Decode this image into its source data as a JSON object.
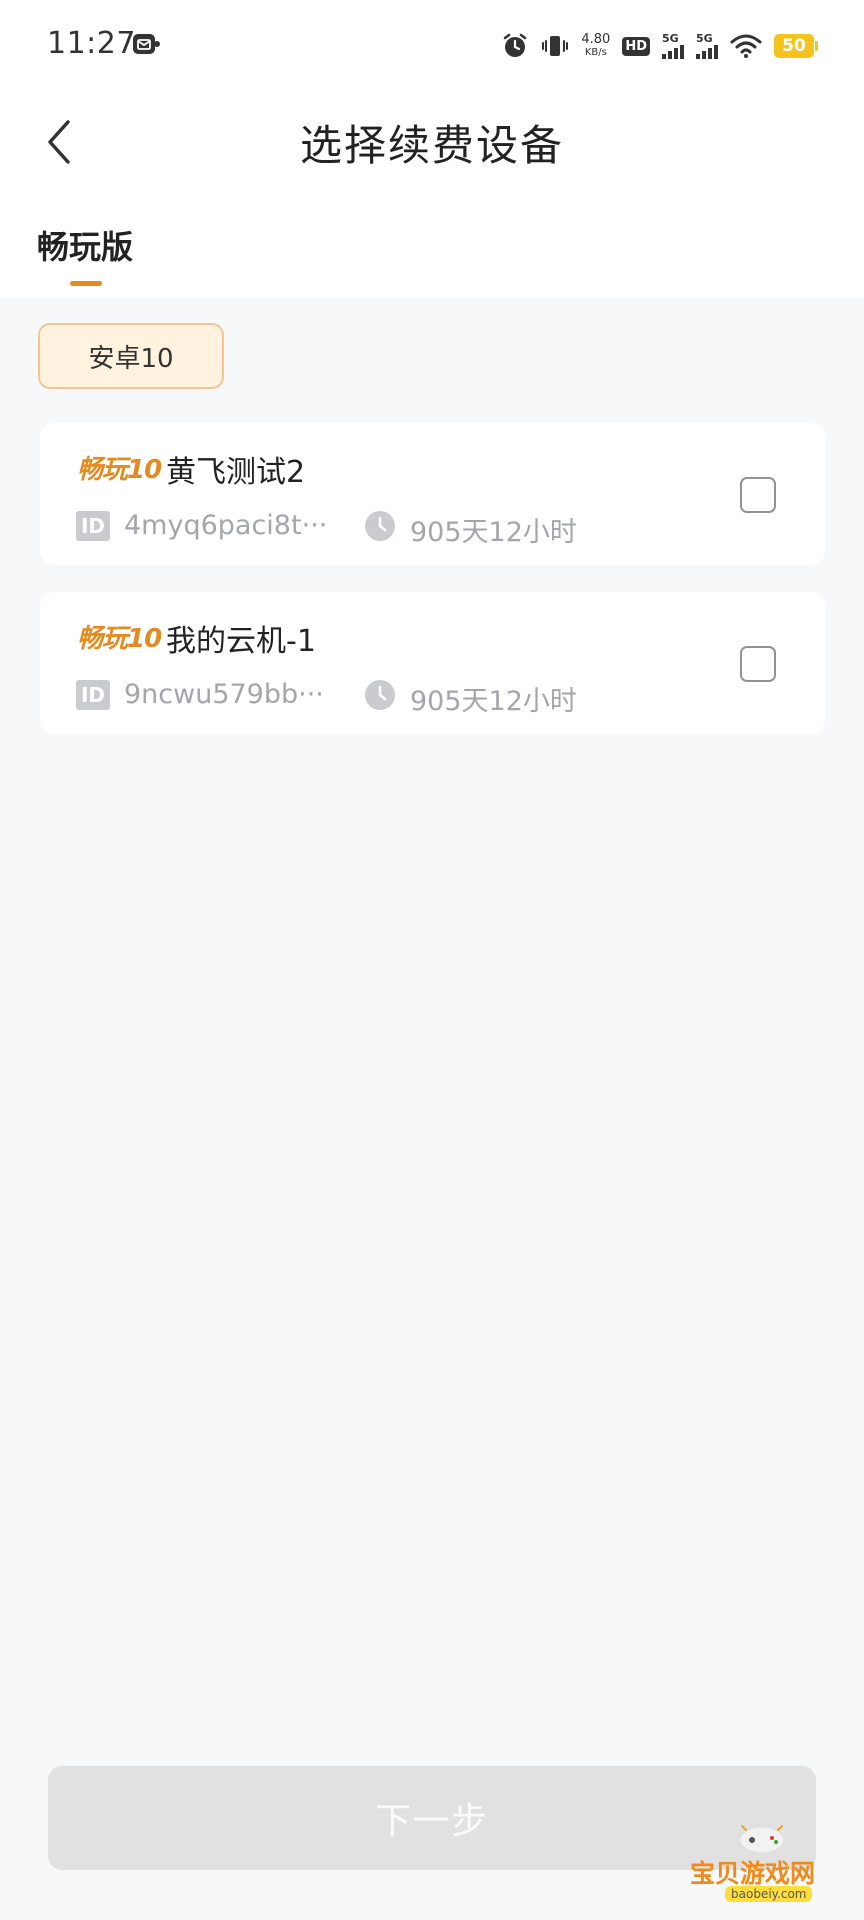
{
  "status_bar": {
    "time": "11:27",
    "net_speed_value": "4.80",
    "net_speed_unit": "KB/s",
    "hd_label": "HD",
    "sim1_label": "5G",
    "sim2_label": "5G",
    "battery_level": "50",
    "battery_color": "#f4c31c"
  },
  "header": {
    "title": "选择续费设备"
  },
  "tabs": [
    {
      "label": "畅玩版",
      "active": true
    }
  ],
  "filter": {
    "chip_label": "安卓10"
  },
  "devices": [
    {
      "brand": "畅玩10",
      "name": "黄飞测试2",
      "id_badge": "ID",
      "id": "4myq6paci8t···",
      "duration": "905天12小时",
      "checked": false
    },
    {
      "brand": "畅玩10",
      "name": "我的云机-1",
      "id_badge": "ID",
      "id": "9ncwu579bb···",
      "duration": "905天12小时",
      "checked": false
    }
  ],
  "footer": {
    "next_label": "下一步"
  },
  "watermark": {
    "text": "宝贝游戏网",
    "url": "baobeiy.com"
  },
  "colors": {
    "accent": "#e58a1f",
    "background": "#f7f8fa",
    "disabled_button": "#e1e1e2"
  }
}
